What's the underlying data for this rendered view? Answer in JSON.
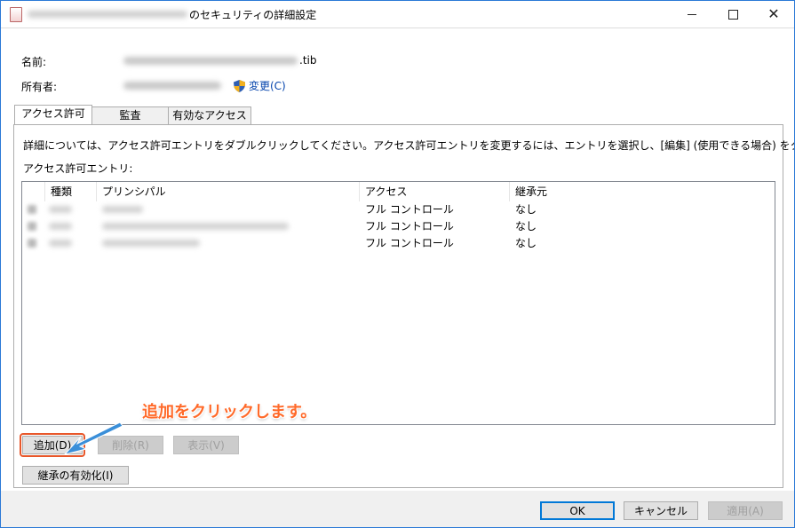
{
  "window": {
    "title": "のセキュリティの詳細設定"
  },
  "properties": {
    "name_label": "名前:",
    "name_suffix": ".tib",
    "owner_label": "所有者:",
    "change_link": "変更(C)"
  },
  "tabs": [
    {
      "label": "アクセス許可",
      "active": true
    },
    {
      "label": "監査",
      "active": false
    },
    {
      "label": "有効なアクセス",
      "active": false
    }
  ],
  "panel": {
    "instructions": "詳細については、アクセス許可エントリをダブルクリックしてください。アクセス許可エントリを変更するには、エントリを選択し、[編集] (使用できる場合) をクリックします。",
    "entries_label": "アクセス許可エントリ:",
    "columns": [
      "種類",
      "プリンシパル",
      "アクセス",
      "継承元"
    ],
    "rows": [
      {
        "access": "フル コントロール",
        "inherited": "なし"
      },
      {
        "access": "フル コントロール",
        "inherited": "なし"
      },
      {
        "access": "フル コントロール",
        "inherited": "なし"
      }
    ]
  },
  "buttons": {
    "add": "追加(D)",
    "remove": "削除(R)",
    "view": "表示(V)",
    "enable_inheritance": "継承の有効化(I)",
    "ok": "OK",
    "cancel": "キャンセル",
    "apply": "適用(A)"
  },
  "annotation": {
    "text": "追加をクリックします。",
    "color": "#ff6a2a"
  },
  "colors": {
    "accent": "#0078d7",
    "highlight_outline": "#e8572a",
    "arrow": "#3a8fd9"
  }
}
